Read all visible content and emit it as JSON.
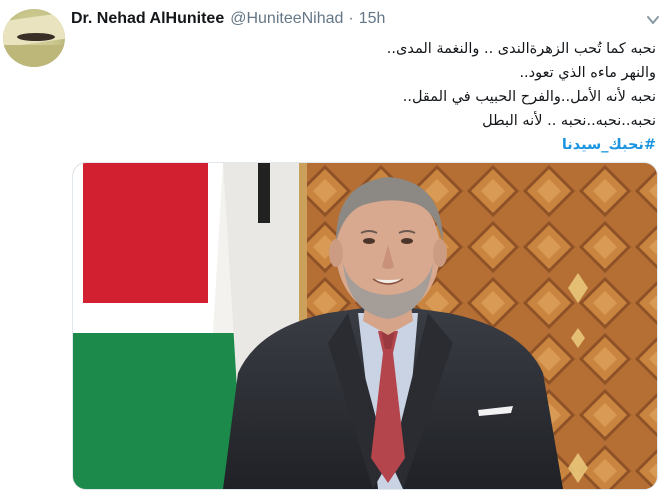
{
  "user": {
    "display_name": "Dr. Nehad AlHunitee",
    "handle": "@HuniteeNihad",
    "separator": "·",
    "time": "15h"
  },
  "tweet": {
    "lines": [
      "نحبه كما تُحب الزهرةالندى .. والنغمة المدى..",
      "والنهر ماءه الذي تعود..",
      "نحبه لأنه الأمل..والفرح الحبيب في المقل..",
      "نحبه..نحبه..نحبه .. لأنه البطل"
    ],
    "hashtag": "#نحبك_سيدنا"
  },
  "icons": {
    "menu": "chevron-down-icon"
  },
  "colors": {
    "name": "#14171a",
    "secondary": "#657786",
    "link": "#1b95e0"
  }
}
